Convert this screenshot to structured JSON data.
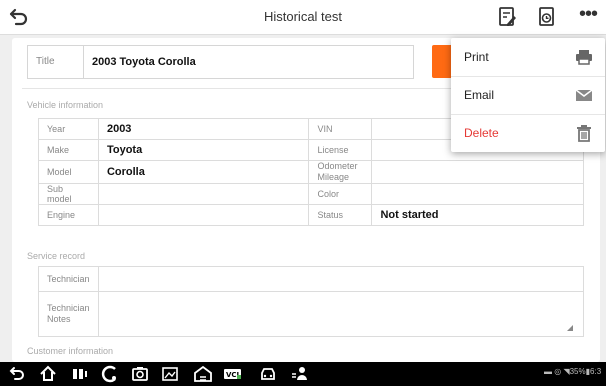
{
  "header": {
    "title": "Historical test"
  },
  "title_field": {
    "label": "Title",
    "value": "2003 Toyota Corolla"
  },
  "vehicle_info": {
    "section_label": "Vehicle information",
    "rows": [
      {
        "l1": "Year",
        "v1": "2003",
        "l2": "VIN",
        "v2": ""
      },
      {
        "l1": "Make",
        "v1": "Toyota",
        "l2": "License",
        "v2": ""
      },
      {
        "l1": "Model",
        "v1": "Corolla",
        "l2": "Odometer Mileage",
        "v2": ""
      },
      {
        "l1": "Sub model",
        "v1": "",
        "l2": "Color",
        "v2": ""
      },
      {
        "l1": "Engine",
        "v1": "",
        "l2": "Status",
        "v2": "Not started"
      }
    ]
  },
  "service_record": {
    "section_label": "Service record",
    "technician_label": "Technician",
    "technician_value": "",
    "notes_label": "Technician Notes",
    "notes_value": ""
  },
  "customer_info": {
    "section_label": "Customer information"
  },
  "menu": {
    "items": [
      {
        "label": "Print",
        "icon": "printer-icon"
      },
      {
        "label": "Email",
        "icon": "envelope-icon"
      },
      {
        "label": "Delete",
        "icon": "trash-icon",
        "color": "#e53935"
      }
    ]
  },
  "status_bar": {
    "battery": "35%",
    "time": "6:3"
  },
  "colors": {
    "accent": "#ff6a13",
    "delete": "#e53935"
  }
}
